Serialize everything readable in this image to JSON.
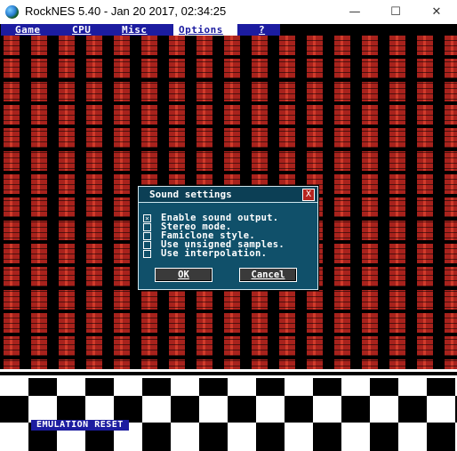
{
  "window": {
    "title": "RockNES 5.40 - Jan 20 2017, 02:34:25",
    "minimize_glyph": "—",
    "maximize_glyph": "☐",
    "close_glyph": "✕"
  },
  "menu": {
    "items": [
      {
        "label": "Game"
      },
      {
        "label": "CPU"
      },
      {
        "label": "Misc"
      },
      {
        "label": "Options"
      },
      {
        "label": "?"
      }
    ],
    "active": "Options"
  },
  "dialog": {
    "title": "Sound settings",
    "close_glyph": "X",
    "options": [
      {
        "label": "Enable sound output.",
        "checked": true
      },
      {
        "label": "Stereo mode.",
        "checked": false
      },
      {
        "label": "Famiclone style.",
        "checked": false
      },
      {
        "label": "Use unsigned samples.",
        "checked": false
      },
      {
        "label": "Use interpolation.",
        "checked": false
      }
    ],
    "ok_label": "OK",
    "cancel_label": "Cancel"
  },
  "status": {
    "text": "EMULATION RESET"
  },
  "colors": {
    "menu_bg": "#1c1ca0",
    "dialog_bg": "#10506a",
    "brick_red": "#a8221c"
  }
}
